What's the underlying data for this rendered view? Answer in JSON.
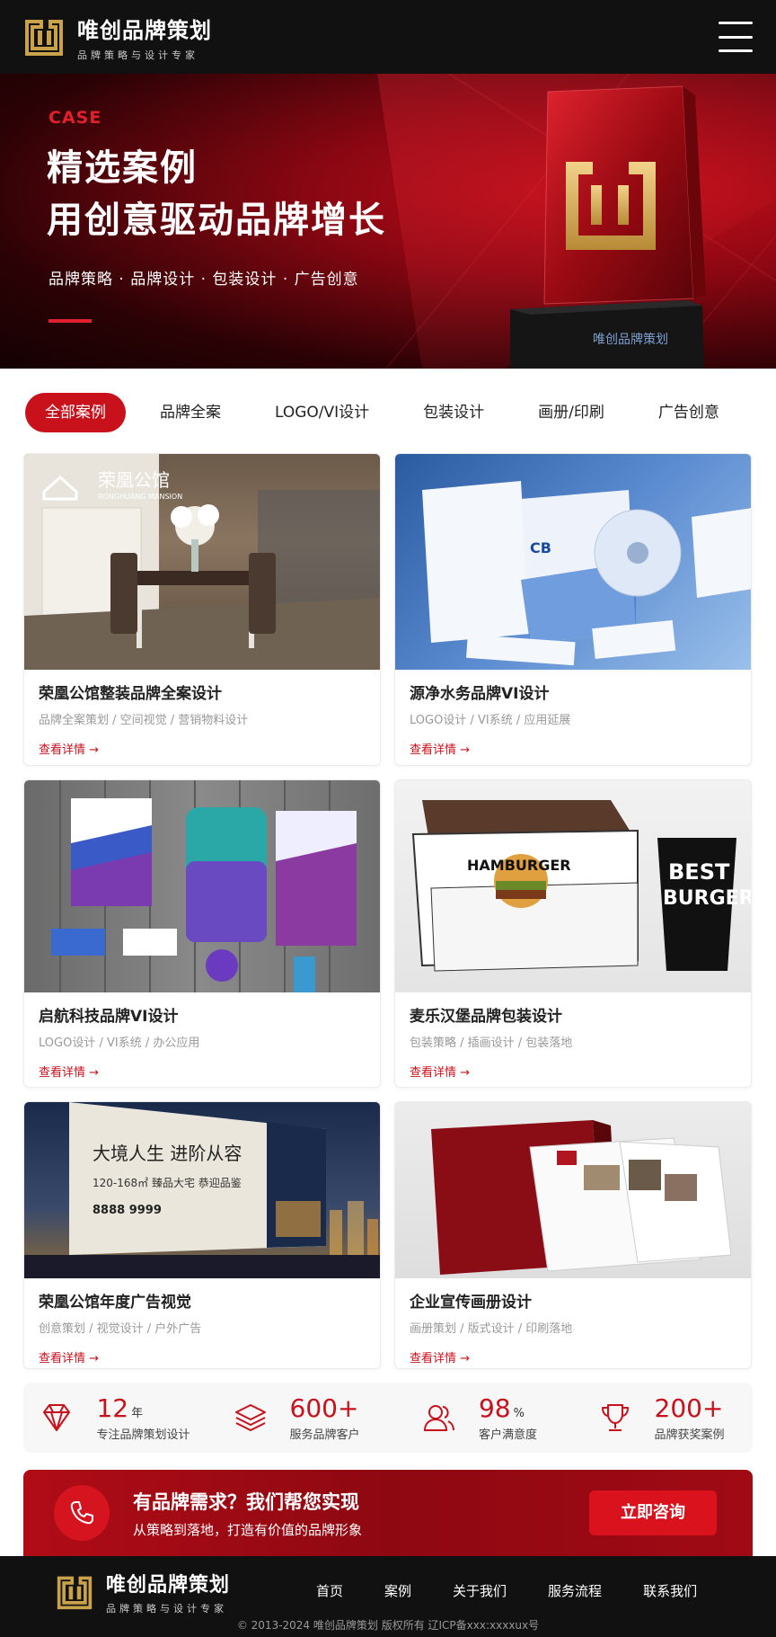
{
  "header": {
    "brand_name": "唯创品牌策划",
    "tagline": "品牌策略与设计专家",
    "menu_icon": "hamburger-icon"
  },
  "hero": {
    "eyebrow": "CASE",
    "title_line1": "精选案例",
    "title_line2": "用创意驱动品牌增长",
    "services": "品牌策略 · 品牌设计 · 包装设计 · 广告创意",
    "trophy_label": "唯创品牌策划",
    "accent": "#e0202c"
  },
  "tabs": [
    {
      "label": "全部案例",
      "active": true
    },
    {
      "label": "品牌全案",
      "active": false
    },
    {
      "label": "LOGO/VI设计",
      "active": false
    },
    {
      "label": "包装设计",
      "active": false
    },
    {
      "label": "画册/印刷",
      "active": false
    },
    {
      "label": "广告创意",
      "active": false
    }
  ],
  "cases": [
    {
      "title": "荣凰公馆整装品牌全案设计",
      "tags": "品牌全案策划 / 空间视觉 / 营销物料设计",
      "link": "查看详情 →",
      "img_brand": "荣凰公馆",
      "img_brand_sub": "RONGHUANG MANSION"
    },
    {
      "title": "源净水务品牌VI设计",
      "tags": "LOGO设计 / VI系统 / 应用延展",
      "link": "查看详情 →"
    },
    {
      "title": "启航科技品牌VI设计",
      "tags": "LOGO设计 / VI系统 / 办公应用",
      "link": "查看详情 →"
    },
    {
      "title": "麦乐汉堡品牌包装设计",
      "tags": "包装策略 / 插画设计 / 包装落地",
      "link": "查看详情 →",
      "img_brand": "HAMBURGER",
      "img_cup_line1": "BEST",
      "img_cup_line2": "BURGER"
    },
    {
      "title": "荣凰公馆年度广告视觉",
      "tags": "创意策划 / 视觉设计 / 户外广告",
      "link": "查看详情 →",
      "img_board_line1": "大境人生 进阶从容",
      "img_board_line2": "120-168㎡ 臻品大宅 恭迎品鉴",
      "img_board_line3": "8888 9999"
    },
    {
      "title": "企业宣传画册设计",
      "tags": "画册策划 / 版式设计 / 印刷落地",
      "link": "查看详情 →"
    }
  ],
  "stats": [
    {
      "icon": "diamond-icon",
      "number": "12",
      "unit": "年",
      "label": "专注品牌策划设计"
    },
    {
      "icon": "layers-icon",
      "number": "600+",
      "unit": "",
      "label": "服务品牌客户"
    },
    {
      "icon": "users-icon",
      "number": "98",
      "unit": "%",
      "label": "客户满意度"
    },
    {
      "icon": "trophy-icon",
      "number": "200+",
      "unit": "",
      "label": "品牌获奖案例"
    }
  ],
  "cta": {
    "title": "有品牌需求？我们帮您实现",
    "subtitle": "从策略到落地，打造有价值的品牌形象",
    "button": "立即咨询",
    "icon": "phone-icon"
  },
  "footer": {
    "brand_name": "唯创品牌策划",
    "tagline": "品牌策略与设计专家",
    "nav": [
      "首页",
      "案例",
      "关于我们",
      "服务流程",
      "联系我们"
    ],
    "copyright": "© 2013-2024 唯创品牌策划 版权所有   辽ICP备xxx:xxxxux号"
  }
}
